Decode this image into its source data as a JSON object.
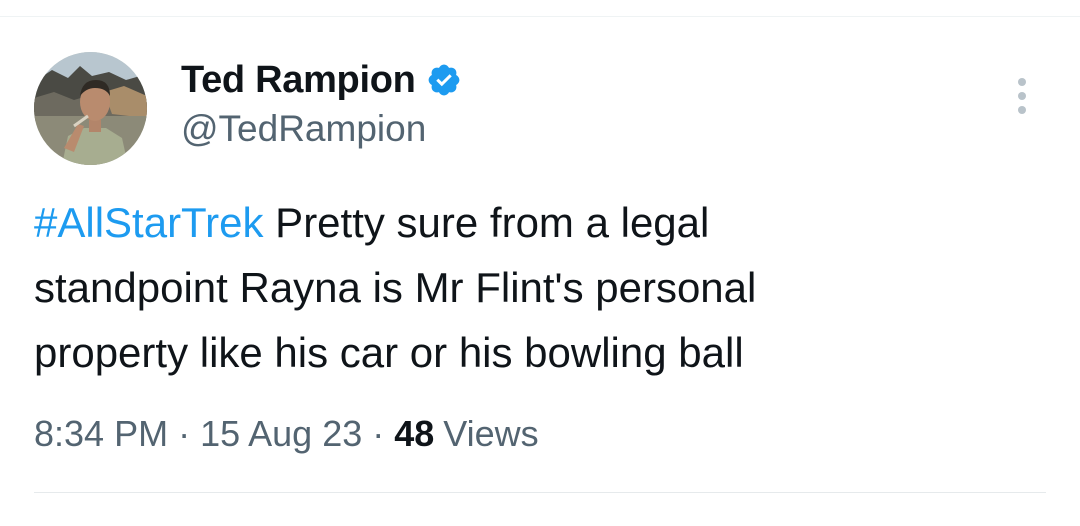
{
  "author": {
    "display_name": "Ted Rampion",
    "handle": "@TedRampion",
    "verified": true
  },
  "tweet": {
    "hashtag": "#AllStarTrek",
    "line1_rest": " Pretty sure from a legal",
    "line2": "standpoint Rayna is Mr Flint's personal",
    "line3": "property like his car or his bowling ball"
  },
  "meta": {
    "time": "8:34 PM",
    "separator": "·",
    "date": "15 Aug 23",
    "views_count": "48",
    "views_label": "Views"
  },
  "colors": {
    "link_blue": "#1d9bf0",
    "verified_blue": "#1d9bf0",
    "secondary_text": "#536471",
    "primary_text": "#0f1419"
  },
  "icons": {
    "verified": "verified-badge-icon",
    "more": "more-vertical-icon"
  }
}
